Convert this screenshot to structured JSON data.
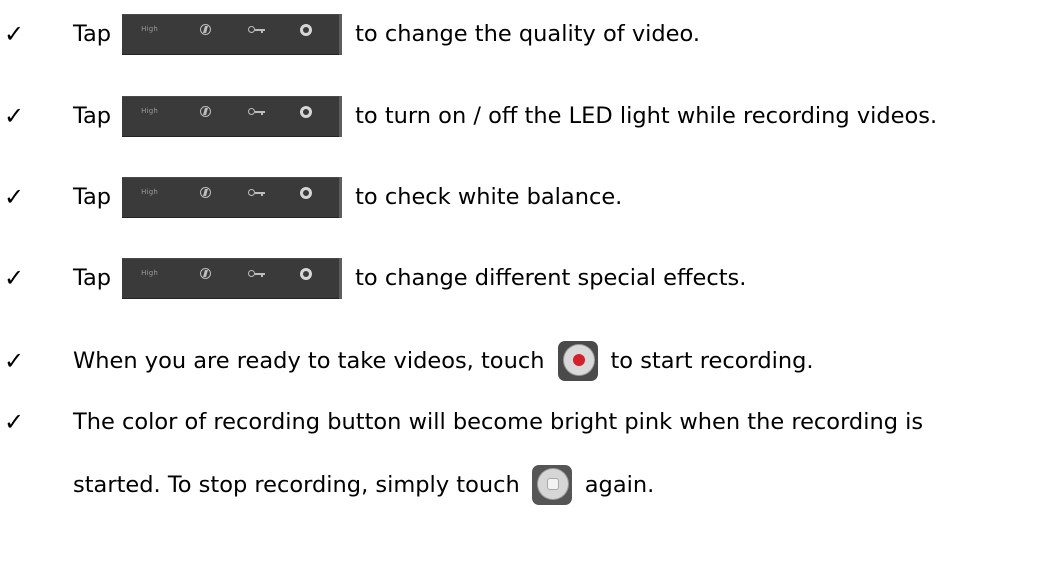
{
  "check_mark": "✓",
  "items": [
    {
      "prefix": "Tap",
      "suffix": "to change the quality of video."
    },
    {
      "prefix": "Tap",
      "suffix": "to turn on / off the LED light while recording videos."
    },
    {
      "prefix": "Tap",
      "suffix": "to check white balance."
    },
    {
      "prefix": "Tap",
      "suffix": "to change different special effects."
    },
    {
      "prefix": "When you are ready to take videos, touch",
      "suffix": "to start recording."
    },
    {
      "prefix": "The color of recording button will become bright pink when the recording is"
    }
  ],
  "continuation": {
    "prefix": "started. To stop recording, simply touch",
    "suffix": "again."
  },
  "toolbar": {
    "quality_label": "High",
    "icons": [
      "flash-icon",
      "key-icon",
      "gear-icon"
    ]
  },
  "buttons": {
    "record_icon": "record-icon",
    "stop_icon": "stop-icon"
  },
  "colors": {
    "toolbar_bg": "#3a3a3a",
    "record_dot": "#d4202a"
  }
}
